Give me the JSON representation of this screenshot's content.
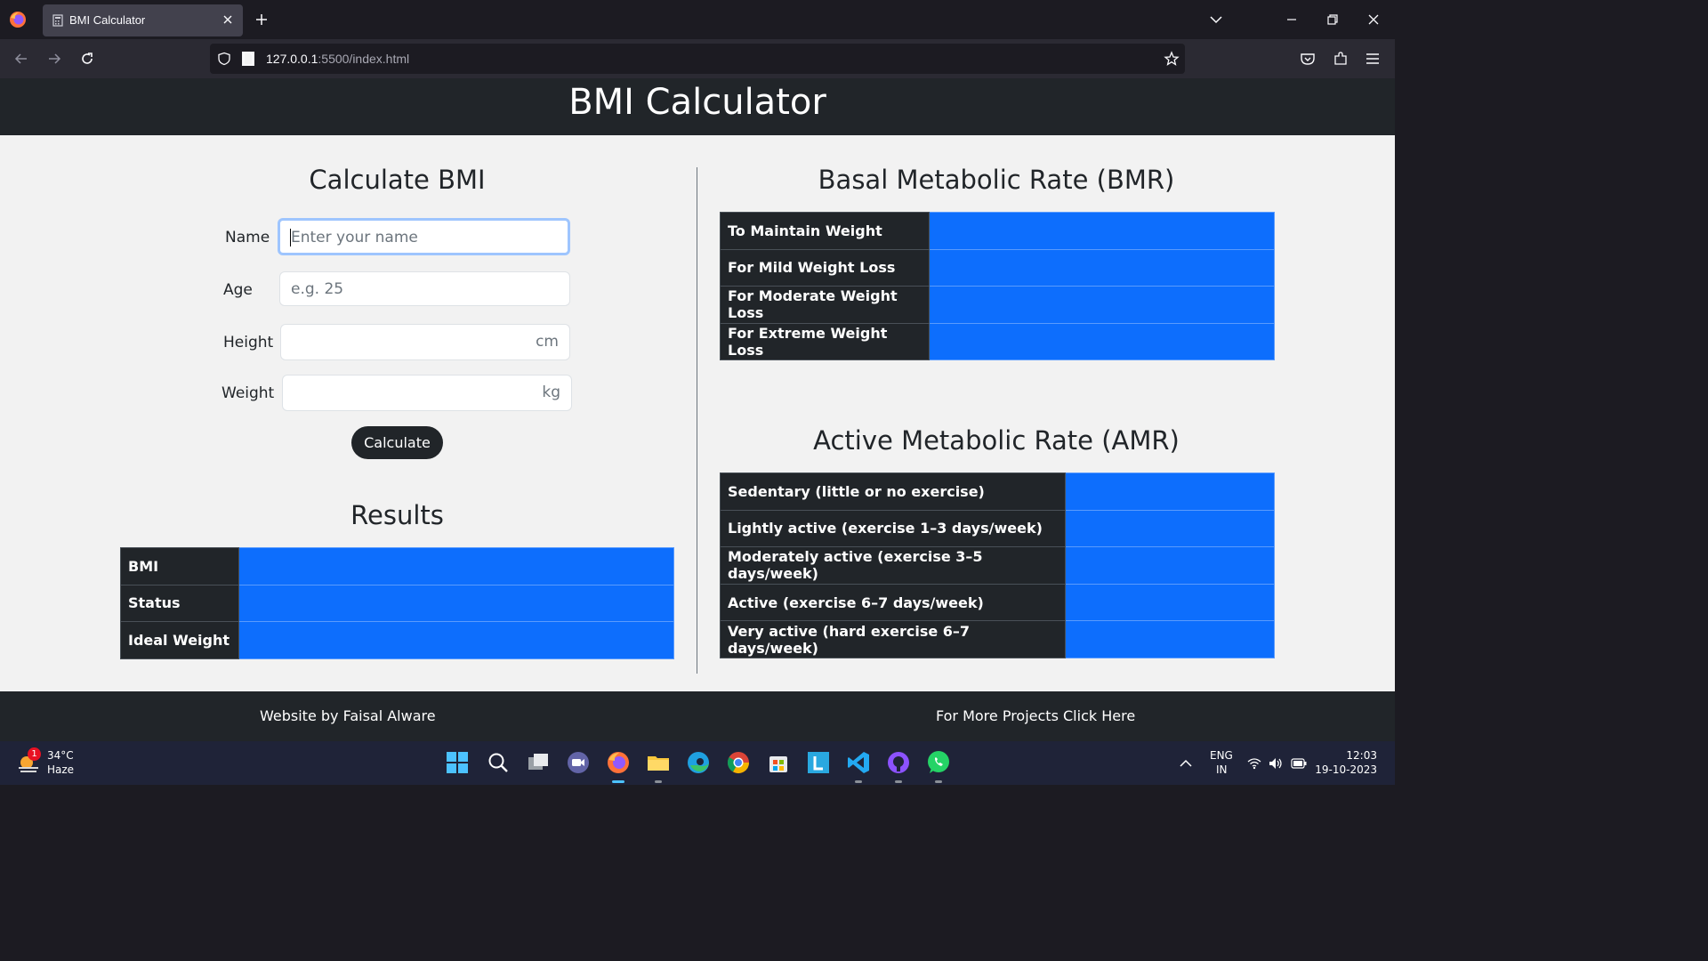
{
  "browser": {
    "tab_title": "BMI Calculator",
    "url_host": "127.0.0.1",
    "url_rest": ":5500/index.html"
  },
  "header": {
    "title": "BMI Calculator"
  },
  "calculator": {
    "title": "Calculate BMI",
    "name_label": "Name",
    "name_placeholder": "Enter your name",
    "age_label": "Age",
    "age_placeholder": "e.g. 25",
    "height_label": "Height",
    "height_unit": "cm",
    "weight_label": "Weight",
    "weight_unit": "kg",
    "button_label": "Calculate"
  },
  "results": {
    "title": "Results",
    "rows": [
      {
        "label": "BMI",
        "value": ""
      },
      {
        "label": "Status",
        "value": ""
      },
      {
        "label": "Ideal Weight",
        "value": ""
      }
    ]
  },
  "bmr": {
    "title": "Basal Metabolic Rate (BMR)",
    "rows": [
      {
        "label": "To Maintain Weight",
        "value": ""
      },
      {
        "label": "For Mild Weight Loss",
        "value": ""
      },
      {
        "label": "For Moderate Weight Loss",
        "value": ""
      },
      {
        "label": "For Extreme Weight Loss",
        "value": ""
      }
    ]
  },
  "amr": {
    "title": "Active Metabolic Rate (AMR)",
    "rows": [
      {
        "label": "Sedentary (little or no exercise)",
        "value": ""
      },
      {
        "label": "Lightly active (exercise 1–3 days/week)",
        "value": ""
      },
      {
        "label": "Moderately active (exercise 3–5 days/week)",
        "value": ""
      },
      {
        "label": "Active (exercise 6–7 days/week)",
        "value": ""
      },
      {
        "label": "Very active (hard exercise 6–7 days/week)",
        "value": ""
      }
    ]
  },
  "footer": {
    "credit": "Website by Faisal Alware",
    "projects_link": "For More Projects Click Here"
  },
  "taskbar": {
    "weather_badge": "1",
    "temperature": "34°C",
    "condition": "Haze",
    "lang_top": "ENG",
    "lang_bottom": "IN",
    "time": "12:03",
    "date": "19-10-2023"
  },
  "colors": {
    "header_bg": "#212529",
    "result_cell": "#0d6efd",
    "page_bg": "#f2f2f2"
  }
}
